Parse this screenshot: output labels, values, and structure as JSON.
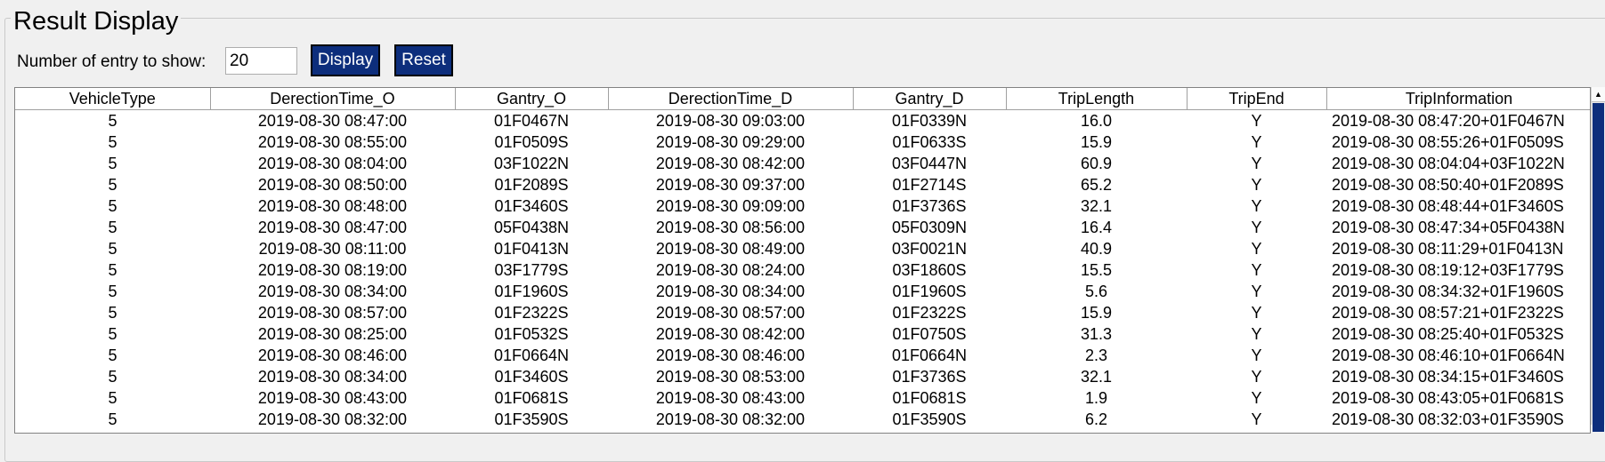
{
  "groupbox": {
    "title": "Result Display"
  },
  "controls": {
    "entry_label": "Number of entry to show:",
    "entry_value": "20",
    "display_label": "Display",
    "reset_label": "Reset"
  },
  "table": {
    "columns": [
      "VehicleType",
      "DerectionTime_O",
      "Gantry_O",
      "DerectionTime_D",
      "Gantry_D",
      "TripLength",
      "TripEnd",
      "TripInformation"
    ],
    "rows": [
      [
        "5",
        "2019-08-30 08:47:00",
        "01F0467N",
        "2019-08-30 09:03:00",
        "01F0339N",
        "16.0",
        "Y",
        "2019-08-30 08:47:20+01F0467N"
      ],
      [
        "5",
        "2019-08-30 08:55:00",
        "01F0509S",
        "2019-08-30 09:29:00",
        "01F0633S",
        "15.9",
        "Y",
        "2019-08-30 08:55:26+01F0509S"
      ],
      [
        "5",
        "2019-08-30 08:04:00",
        "03F1022N",
        "2019-08-30 08:42:00",
        "03F0447N",
        "60.9",
        "Y",
        "2019-08-30 08:04:04+03F1022N"
      ],
      [
        "5",
        "2019-08-30 08:50:00",
        "01F2089S",
        "2019-08-30 09:37:00",
        "01F2714S",
        "65.2",
        "Y",
        "2019-08-30 08:50:40+01F2089S"
      ],
      [
        "5",
        "2019-08-30 08:48:00",
        "01F3460S",
        "2019-08-30 09:09:00",
        "01F3736S",
        "32.1",
        "Y",
        "2019-08-30 08:48:44+01F3460S"
      ],
      [
        "5",
        "2019-08-30 08:47:00",
        "05F0438N",
        "2019-08-30 08:56:00",
        "05F0309N",
        "16.4",
        "Y",
        "2019-08-30 08:47:34+05F0438N"
      ],
      [
        "5",
        "2019-08-30 08:11:00",
        "01F0413N",
        "2019-08-30 08:49:00",
        "03F0021N",
        "40.9",
        "Y",
        "2019-08-30 08:11:29+01F0413N"
      ],
      [
        "5",
        "2019-08-30 08:19:00",
        "03F1779S",
        "2019-08-30 08:24:00",
        "03F1860S",
        "15.5",
        "Y",
        "2019-08-30 08:19:12+03F1779S"
      ],
      [
        "5",
        "2019-08-30 08:34:00",
        "01F1960S",
        "2019-08-30 08:34:00",
        "01F1960S",
        "5.6",
        "Y",
        "2019-08-30 08:34:32+01F1960S"
      ],
      [
        "5",
        "2019-08-30 08:57:00",
        "01F2322S",
        "2019-08-30 08:57:00",
        "01F2322S",
        "15.9",
        "Y",
        "2019-08-30 08:57:21+01F2322S"
      ],
      [
        "5",
        "2019-08-30 08:25:00",
        "01F0532S",
        "2019-08-30 08:42:00",
        "01F0750S",
        "31.3",
        "Y",
        "2019-08-30 08:25:40+01F0532S"
      ],
      [
        "5",
        "2019-08-30 08:46:00",
        "01F0664N",
        "2019-08-30 08:46:00",
        "01F0664N",
        "2.3",
        "Y",
        "2019-08-30 08:46:10+01F0664N"
      ],
      [
        "5",
        "2019-08-30 08:34:00",
        "01F3460S",
        "2019-08-30 08:53:00",
        "01F3736S",
        "32.1",
        "Y",
        "2019-08-30 08:34:15+01F3460S"
      ],
      [
        "5",
        "2019-08-30 08:43:00",
        "01F0681S",
        "2019-08-30 08:43:00",
        "01F0681S",
        "1.9",
        "Y",
        "2019-08-30 08:43:05+01F0681S"
      ],
      [
        "5",
        "2019-08-30 08:32:00",
        "01F3590S",
        "2019-08-30 08:32:00",
        "01F3590S",
        "6.2",
        "Y",
        "2019-08-30 08:32:03+01F3590S"
      ]
    ]
  },
  "scrollbar": {
    "up_arrow_icon": "up-arrow-icon",
    "thumb_color": "#0d2e7c"
  }
}
